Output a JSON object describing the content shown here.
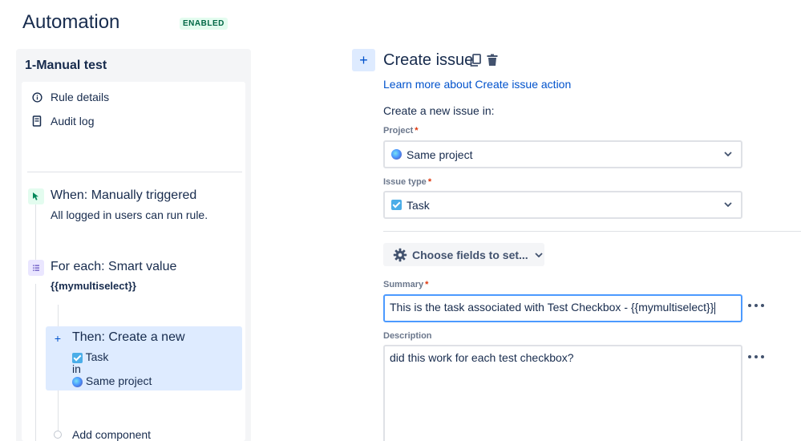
{
  "header": {
    "title": "Automation",
    "status_badge": "ENABLED"
  },
  "rule": {
    "name": "1-Manual test",
    "nav": [
      {
        "label": "Rule details",
        "icon": "info-icon"
      },
      {
        "label": "Audit log",
        "icon": "audit-log-icon"
      }
    ],
    "trigger": {
      "title": "When: Manually triggered",
      "subtitle": "All logged in users can run rule."
    },
    "branch": {
      "title": "For each: Smart value",
      "value": "{{mymultiselect}}"
    },
    "action": {
      "title": "Then: Create a new",
      "issue_type": "Task",
      "connector": "in",
      "project": "Same project"
    },
    "add_component_label": "Add component"
  },
  "editor": {
    "title": "Create issue",
    "learn_more": "Learn more about Create issue action",
    "create_in_label": "Create a new issue in:",
    "project": {
      "label": "Project",
      "value": "Same project"
    },
    "issue_type": {
      "label": "Issue type",
      "value": "Task"
    },
    "choose_fields_label": "Choose fields to set...",
    "summary": {
      "label": "Summary",
      "value": "This is the task associated with Test Checkbox - {{mymultiselect}}"
    },
    "description": {
      "label": "Description",
      "value": "did this work for each test checkbox?"
    }
  },
  "colors": {
    "accent": "#0052cc",
    "selected_bg": "#deebff",
    "panel_bg": "#f4f5f7",
    "enabled_green": "#006644",
    "required_red": "#de350b"
  }
}
